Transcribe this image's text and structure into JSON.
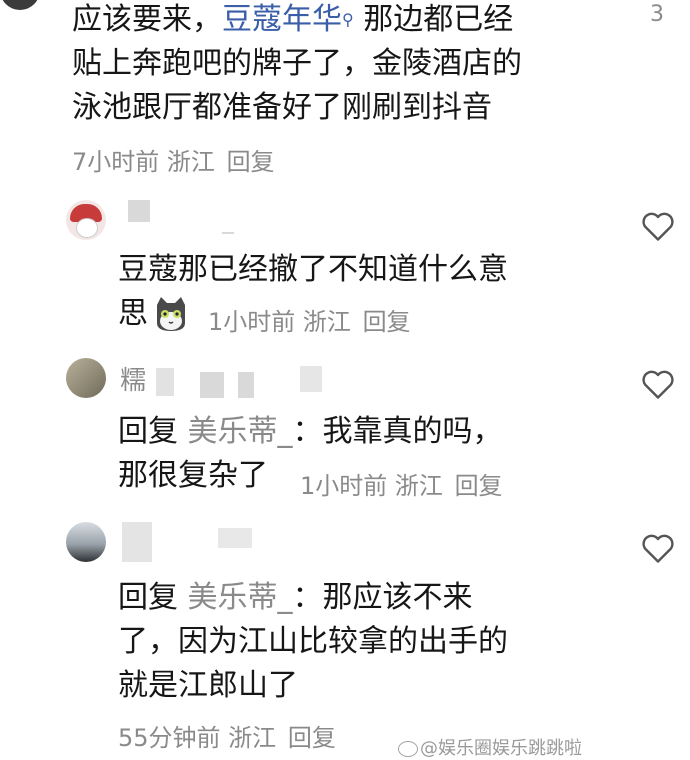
{
  "comments": [
    {
      "text_before_topic": "应该要来，",
      "topic": "豆蔻年华",
      "text_line1_after": "那边都已经",
      "text_line2": "贴上奔跑吧的牌子了，金陵酒店的",
      "text_line3": "泳池跟厅都准备好了刚刷到抖音",
      "time": "7小时前",
      "location": "浙江",
      "reply_label": "回复",
      "like_count": "3"
    },
    {
      "text_line1": "豆蔻那已经撤了不知道什么意",
      "text_line2": "思",
      "time": "1小时前",
      "location": "浙江",
      "reply_label": "回复"
    },
    {
      "username_partial": "糯",
      "reply_prefix": "回复",
      "reply_target": "美乐蒂_",
      "colon": "：",
      "text_line1": "我靠真的吗，",
      "text_line2": "那很复杂了",
      "time": "1小时前",
      "location": "浙江",
      "reply_label": "回复"
    },
    {
      "reply_prefix": "回复",
      "reply_target": "美乐蒂_",
      "colon": "：",
      "text_line1": "那应该不来",
      "text_line2": "了，因为江山比较拿的出手的",
      "text_line3": "就是江郎山了",
      "time": "55分钟前",
      "location": "浙江",
      "reply_label": "回复"
    }
  ],
  "watermark": "@娱乐圈娱乐跳跳啦",
  "icons": {
    "heart": "heart-outline-icon",
    "search": "search-icon"
  }
}
